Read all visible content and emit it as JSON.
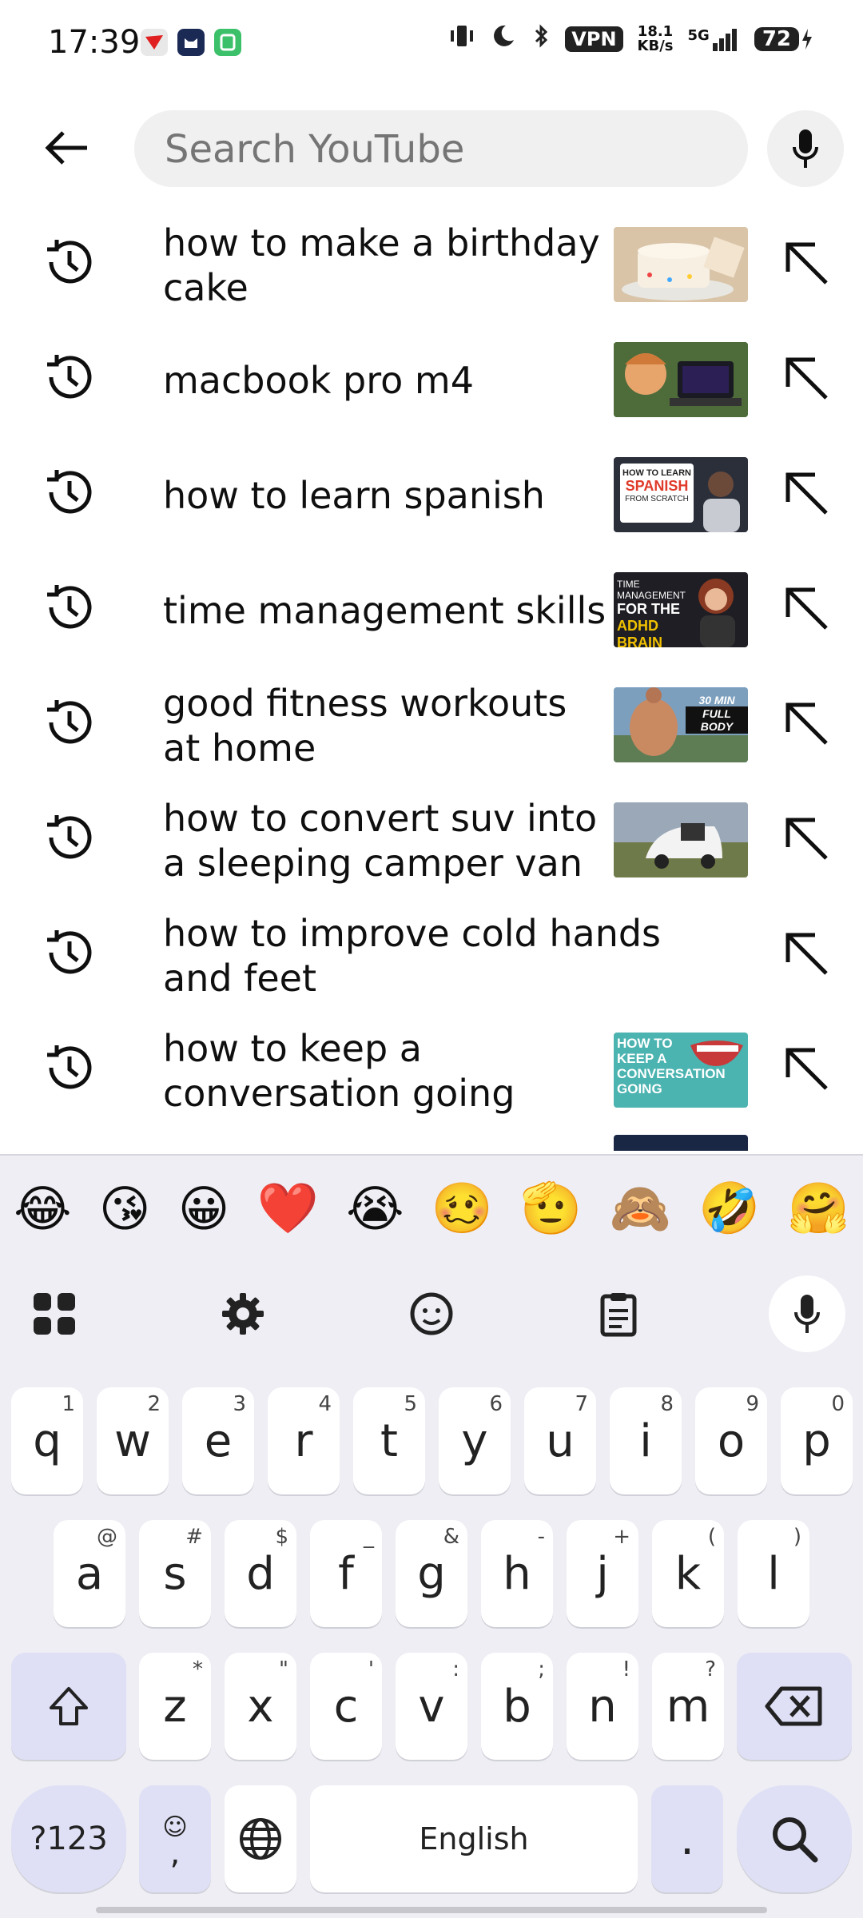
{
  "status_bar": {
    "time": "17:39",
    "vpn": "VPN",
    "speed_value": "18.1",
    "speed_unit": "KB/s",
    "network": "5G",
    "battery": "72"
  },
  "search": {
    "placeholder": "Search YouTube"
  },
  "suggestions": [
    {
      "text": "how to make a birthday cake"
    },
    {
      "text": "macbook pro m4"
    },
    {
      "text": "how to learn spanish"
    },
    {
      "text": "time management skills"
    },
    {
      "text": "good fitness workouts at home"
    },
    {
      "text": "how to convert suv into a sleeping camper van"
    },
    {
      "text": "how to improve cold hands and feet"
    },
    {
      "text": "how to keep a conversation going"
    }
  ],
  "thumbnails": {
    "spanish": {
      "line1": "HOW TO LEARN",
      "line2": "SPANISH",
      "line3": "FROM SCRATCH"
    },
    "time": {
      "line1": "TIME MANAGEMENT",
      "line2": "FOR THE",
      "line3": "ADHD BRAIN"
    },
    "fitness": {
      "line1": "30 MIN",
      "line2": "FULL BODY"
    },
    "conversation": {
      "line1": "HOW TO",
      "line2": "KEEP A",
      "line3": "CONVERSATION",
      "line4": "GOING"
    }
  },
  "emoji_row": [
    "😂",
    "😘",
    "😀",
    "❤️",
    "😭",
    "🥴",
    "🫡",
    "🙈",
    "🤣",
    "🤗"
  ],
  "keyboard": {
    "row1": [
      [
        "q",
        "1"
      ],
      [
        "w",
        "2"
      ],
      [
        "e",
        "3"
      ],
      [
        "r",
        "4"
      ],
      [
        "t",
        "5"
      ],
      [
        "y",
        "6"
      ],
      [
        "u",
        "7"
      ],
      [
        "i",
        "8"
      ],
      [
        "o",
        "9"
      ],
      [
        "p",
        "0"
      ]
    ],
    "row2": [
      [
        "a",
        "@"
      ],
      [
        "s",
        "#"
      ],
      [
        "d",
        "$"
      ],
      [
        "f",
        "_"
      ],
      [
        "g",
        "&"
      ],
      [
        "h",
        "-"
      ],
      [
        "j",
        "+"
      ],
      [
        "k",
        "("
      ],
      [
        "l",
        ")"
      ]
    ],
    "row3": [
      [
        "z",
        "*"
      ],
      [
        "x",
        "\""
      ],
      [
        "c",
        "'"
      ],
      [
        "v",
        ":"
      ],
      [
        "b",
        ";"
      ],
      [
        "n",
        "!"
      ],
      [
        "m",
        "?"
      ]
    ],
    "symbols_label": "?123",
    "comma_label": ",",
    "space_label": "English",
    "period_label": "."
  }
}
